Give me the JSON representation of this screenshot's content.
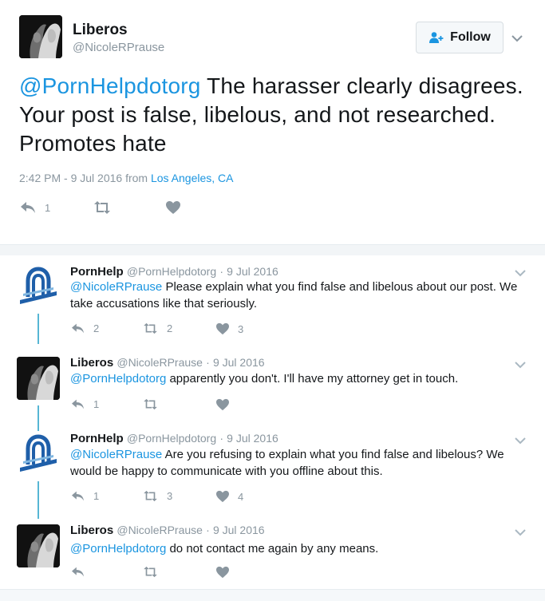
{
  "main_tweet": {
    "author_name": "Liberos",
    "author_handle": "@NicoleRPrause",
    "follow_label": "Follow",
    "mention": "@PornHelpdotorg",
    "text": " The harasser clearly disagrees. Your post is false, libelous, and not researched. Promotes hate",
    "timestamp": "2:42 PM - 9 Jul 2016 from ",
    "location": "Los Angeles, CA",
    "reply_count": "1",
    "retweet_count": "",
    "like_count": ""
  },
  "replies": [
    {
      "author_name": "PornHelp",
      "author_handle": "@PornHelpdotorg",
      "date": "9 Jul 2016",
      "mention": "@NicoleRPrause",
      "text": " Please explain what you find false and libelous about our post. We take accusations like that seriously.",
      "reply_count": "2",
      "retweet_count": "2",
      "like_count": "3"
    },
    {
      "author_name": "Liberos",
      "author_handle": "@NicoleRPrause",
      "date": "9 Jul 2016",
      "mention": "@PornHelpdotorg",
      "text": " apparently you don't. I'll have my attorney get in touch.",
      "reply_count": "1",
      "retweet_count": "",
      "like_count": ""
    },
    {
      "author_name": "PornHelp",
      "author_handle": "@PornHelpdotorg",
      "date": "9 Jul 2016",
      "mention": "@NicoleRPrause",
      "text": " Are you refusing to explain what you find false and libelous? We would be happy to communicate with you offline about this.",
      "reply_count": "1",
      "retweet_count": "3",
      "like_count": "4"
    },
    {
      "author_name": "Liberos",
      "author_handle": "@NicoleRPrause",
      "date": "9 Jul 2016",
      "mention": "@PornHelpdotorg",
      "text": " do not contact me again by any means.",
      "reply_count": "",
      "retweet_count": "",
      "like_count": ""
    }
  ],
  "separator": "·",
  "colors": {
    "link": "#1b95e0",
    "muted": "#8a969f",
    "thread_line": "#57b6d4",
    "brand_blue": "#1f5fa9"
  }
}
